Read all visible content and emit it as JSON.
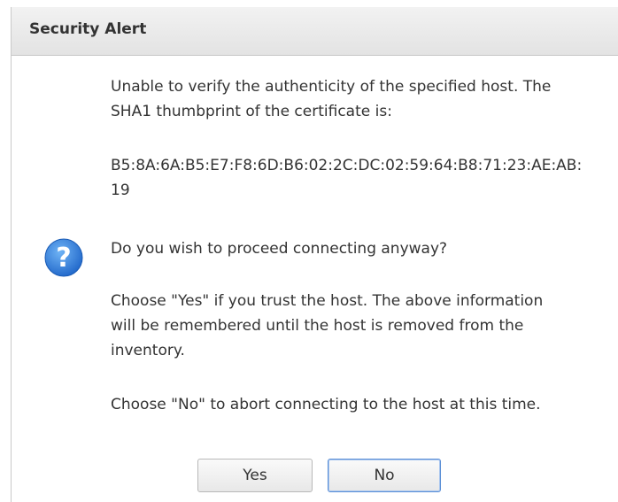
{
  "dialog": {
    "title": "Security Alert",
    "icon": "question-icon",
    "accent_color": "#2f7fd8",
    "paragraphs": {
      "verify": "Unable to verify the authenticity of the specified host. The SHA1 thumbprint of the certificate is:",
      "thumbprint": "B5:8A:6A:B5:E7:F8:6D:B6:02:2C:DC:02:59:64:B8:71:23:AE:AB:19",
      "question": "Do you wish to proceed connecting anyway?",
      "yes_info": "Choose \"Yes\" if you trust the host. The above information will be remembered until the host is removed from the inventory.",
      "no_info": "Choose \"No\" to abort connecting to the host at this time."
    },
    "buttons": {
      "yes": "Yes",
      "no": "No"
    }
  }
}
